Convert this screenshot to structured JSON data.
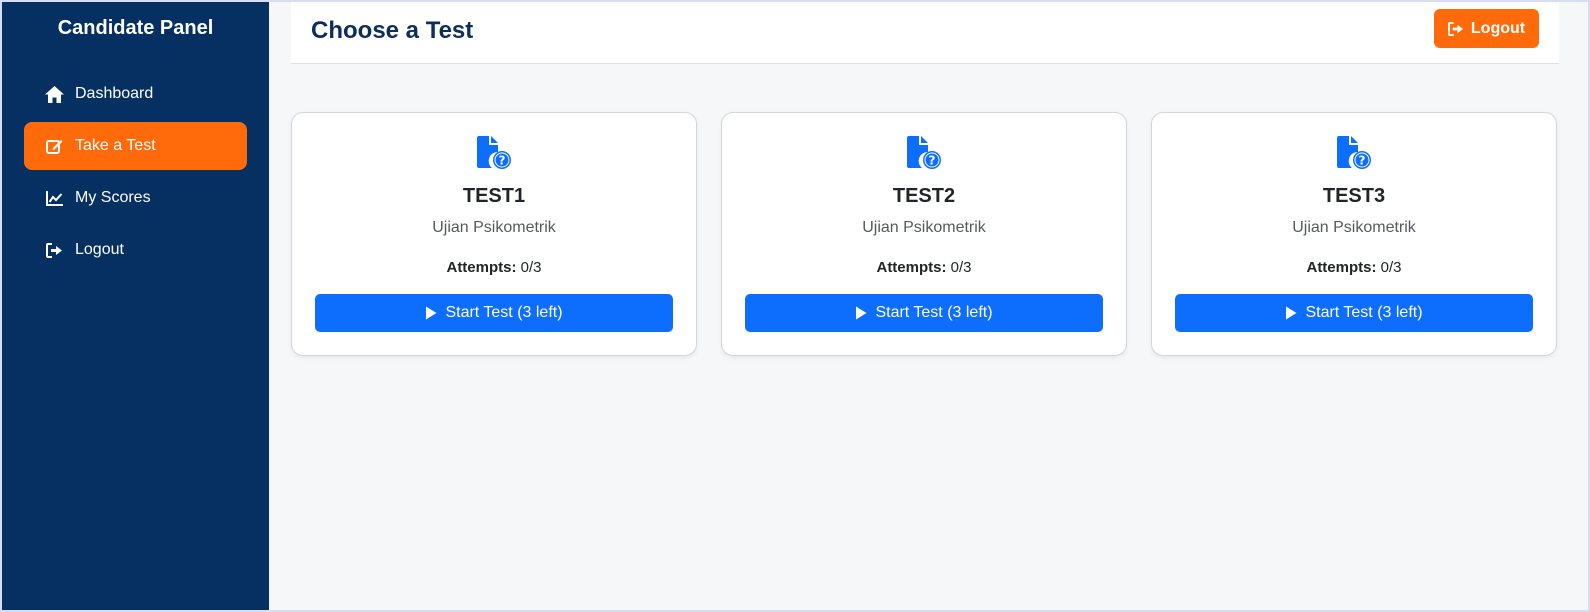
{
  "sidebar": {
    "title": "Candidate Panel",
    "items": [
      {
        "label": "Dashboard",
        "icon": "home-icon",
        "active": false
      },
      {
        "label": "Take a Test",
        "icon": "edit-icon",
        "active": true
      },
      {
        "label": "My Scores",
        "icon": "chart-line-icon",
        "active": false
      },
      {
        "label": "Logout",
        "icon": "logout-icon",
        "active": false
      }
    ]
  },
  "header": {
    "title": "Choose a Test",
    "logout_label": "Logout"
  },
  "tests": [
    {
      "name": "TEST1",
      "subtitle": "Ujian Psikometrik",
      "attempts_label": "Attempts:",
      "attempts_value": "0/3",
      "button_label": "Start Test (3 left)"
    },
    {
      "name": "TEST2",
      "subtitle": "Ujian Psikometrik",
      "attempts_label": "Attempts:",
      "attempts_value": "0/3",
      "button_label": "Start Test (3 left)"
    },
    {
      "name": "TEST3",
      "subtitle": "Ujian Psikometrik",
      "attempts_label": "Attempts:",
      "attempts_value": "0/3",
      "button_label": "Start Test (3 left)"
    }
  ],
  "colors": {
    "sidebar_bg": "#063062",
    "accent_orange": "#ff6b0a",
    "primary_blue": "#0d6efd",
    "title_navy": "#0d2e5c"
  }
}
